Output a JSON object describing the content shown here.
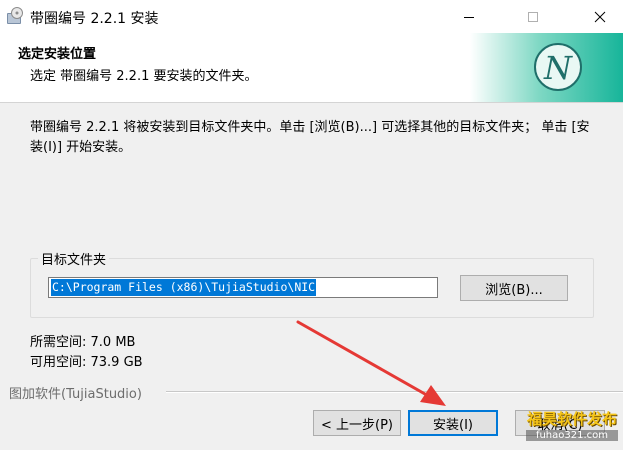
{
  "window": {
    "title": "带圈编号 2.2.1 安装",
    "icons": {
      "app": "installer-disc-icon",
      "minimize": "minimize-icon",
      "maximize": "maximize-icon",
      "close": "close-icon"
    }
  },
  "header": {
    "title": "选定安装位置",
    "subtitle": "选定 带圈编号 2.2.1 要安装的文件夹。",
    "logo_letter": "N",
    "logo_icon": "circle-n-logo-icon"
  },
  "body": {
    "description": "带圈编号 2.2.1 将被安装到目标文件夹中。单击 [浏览(B)...] 可选择其他的目标文件夹； 单击 [安装(I)] 开始安装。"
  },
  "destination": {
    "group_label": "目标文件夹",
    "path_value": "C:\\Program Files (x86)\\TujiaStudio\\NIC",
    "browse_label": "浏览(B)..."
  },
  "space": {
    "required": "所需空间: 7.0 MB",
    "available": "可用空间: 73.9 GB"
  },
  "footer": {
    "brand": "图加软件(TujiaStudio)",
    "back_label": "< 上一步(P)",
    "install_label": "安装(I)",
    "cancel_label": "取消(C)"
  },
  "watermark": {
    "line1": "福昊软件发布",
    "line2": "fuhao321.com"
  },
  "colors": {
    "accent": "#0078d7",
    "arrow": "#e53935",
    "header_gradient_start": "#ffffff",
    "header_gradient_end": "#17b59a"
  }
}
